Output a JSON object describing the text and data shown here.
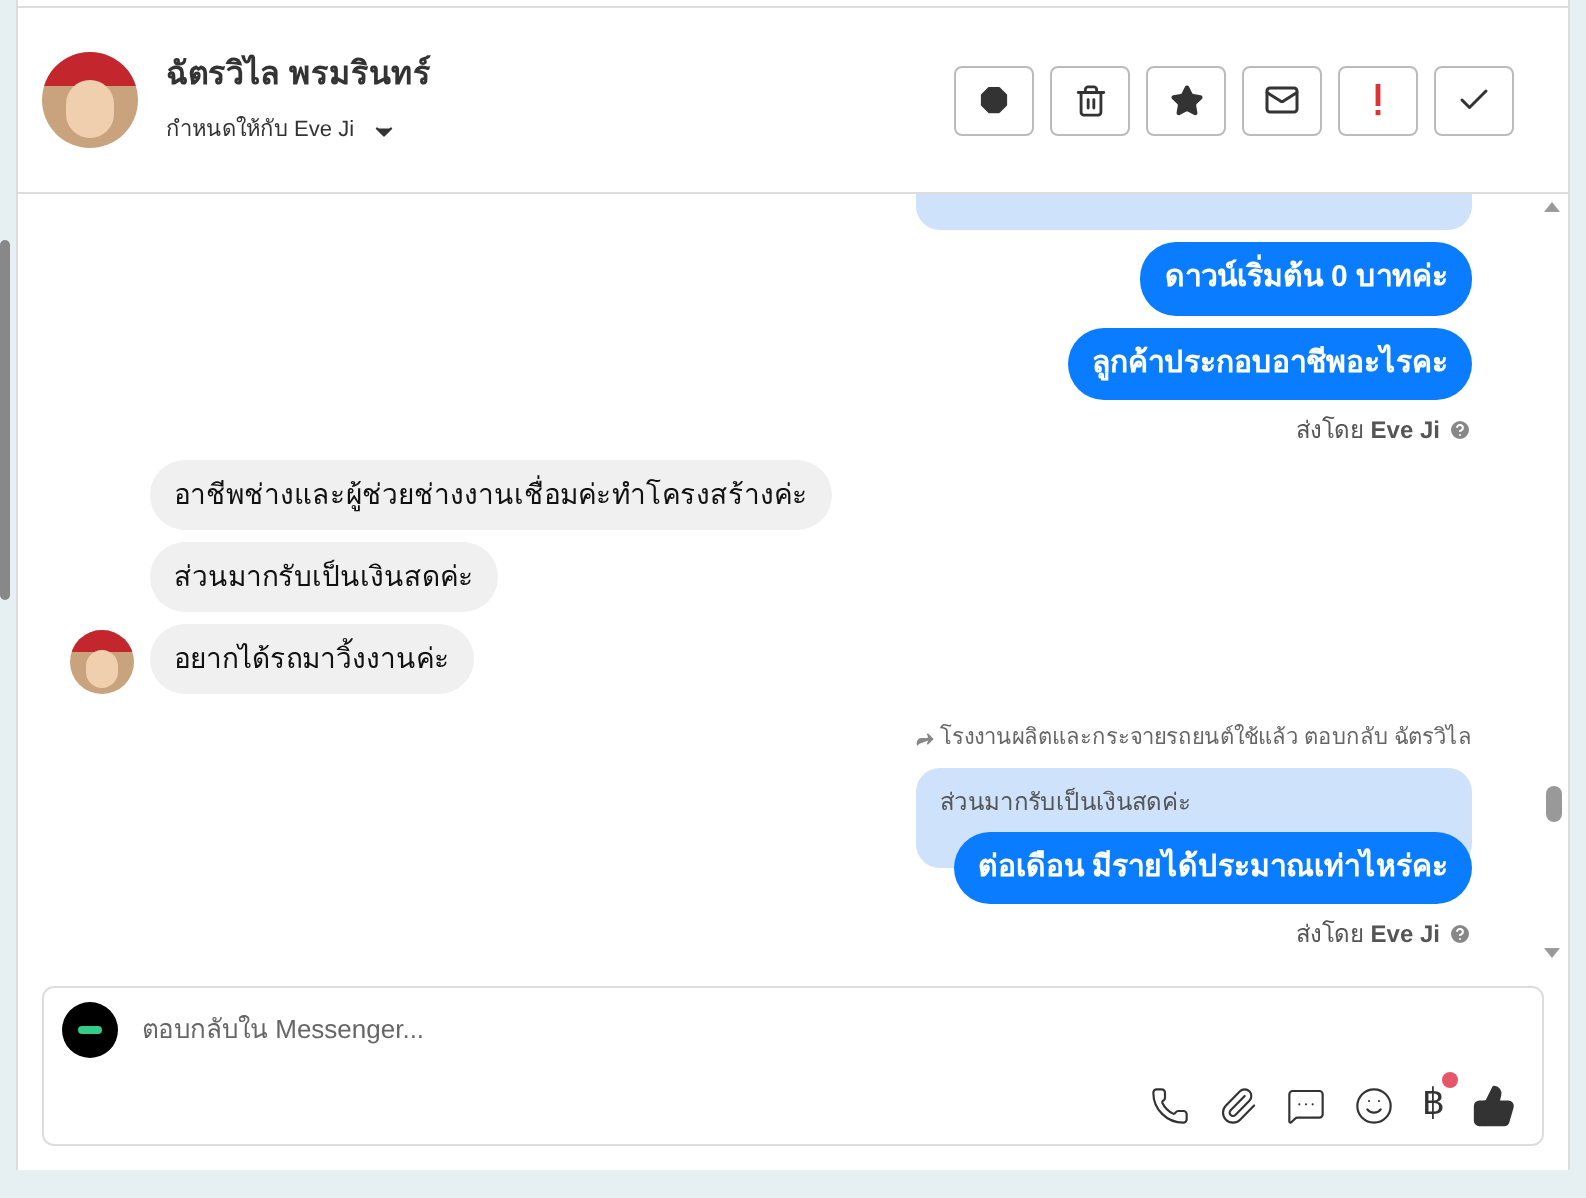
{
  "header": {
    "contact_name": "ฉัตรวิไล พรมรินทร์",
    "assigned_to": "กำหนดให้กับ Eve Ji",
    "actions": [
      {
        "kind": "spam"
      },
      {
        "kind": "delete"
      },
      {
        "kind": "star"
      },
      {
        "kind": "unread"
      },
      {
        "kind": "important"
      },
      {
        "kind": "done"
      }
    ]
  },
  "messages": [
    {
      "kind": "quote-stub"
    },
    {
      "kind": "outgoing",
      "text": "ดาวน์เริ่มต้น 0 บาทค่ะ"
    },
    {
      "kind": "outgoing",
      "text": "ลูกค้าประกอบอาชีพอะไรคะ"
    },
    {
      "kind": "sent-by",
      "text": "ส่งโดย **Eve Ji**"
    },
    {
      "kind": "incoming",
      "text": "อาชีพช่างและผู้ช่วยช่างงานเชื่อมค่ะทำโครงสร้างค่ะ",
      "show_avatar": false
    },
    {
      "kind": "incoming",
      "text": "ส่วนมากรับเป็นเงินสดค่ะ",
      "show_avatar": false
    },
    {
      "kind": "incoming",
      "text": "อยากได้รถมาวิ้งงานค่ะ",
      "show_avatar": true
    },
    {
      "kind": "reply-context",
      "text": "โรงงานผลิตและกระจายรถยนต์ใช้แล้ว ตอบกลับ ฉัตรวิไล"
    },
    {
      "kind": "quoted",
      "text": "ส่วนมากรับเป็นเงินสดค่ะ"
    },
    {
      "kind": "outgoing",
      "text": "ต่อเดือน มีรายได้ประมาณเท่าไหร่คะ"
    },
    {
      "kind": "sent-by",
      "text": "ส่งโดย **Eve Ji**"
    }
  ],
  "composer": {
    "placeholder": "ตอบกลับใน Messenger...",
    "currency_symbol": "฿",
    "currency_has_notification": true
  }
}
